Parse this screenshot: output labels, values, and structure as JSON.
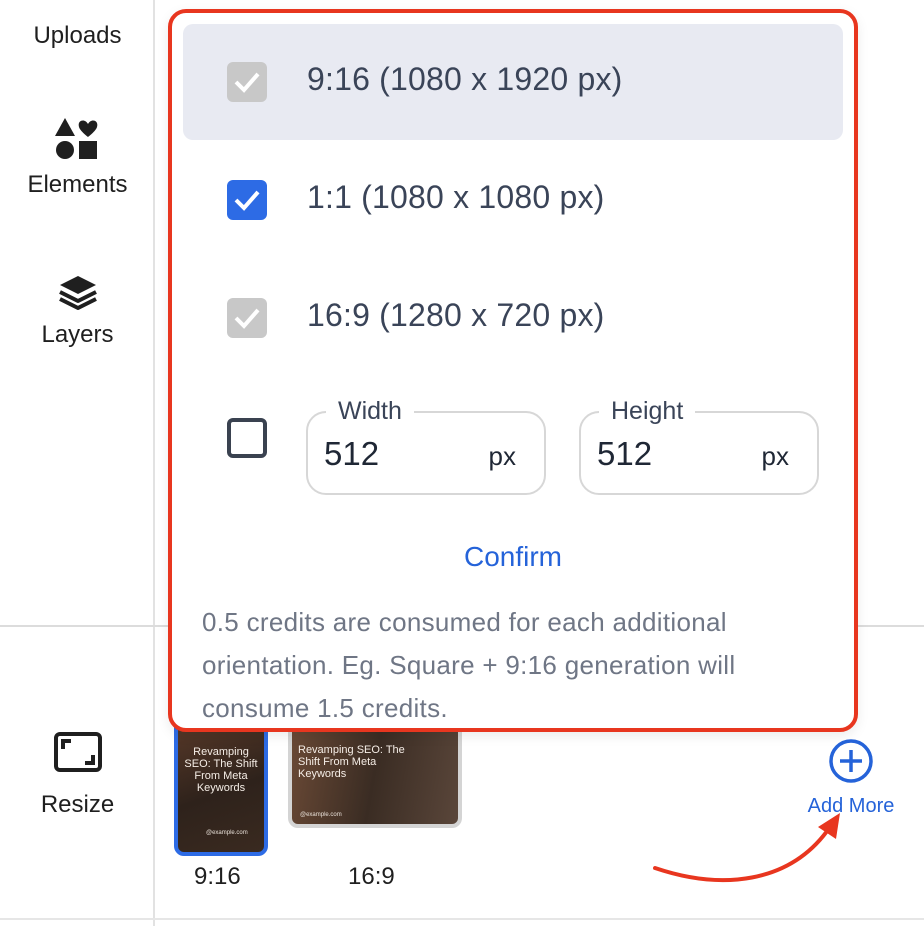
{
  "sidebar": {
    "uploads_label": "Uploads",
    "elements_label": "Elements",
    "elements_icon": "shapes-icon",
    "layers_label": "Layers",
    "layers_icon": "layers-icon",
    "resize_label": "Resize",
    "resize_icon": "resize-icon"
  },
  "popup": {
    "options": [
      {
        "label": "9:16 (1080 x 1920 px)",
        "state": "checked-disabled"
      },
      {
        "label": "1:1 (1080 x 1080 px)",
        "state": "checked"
      },
      {
        "label": "16:9 (1280 x 720 px)",
        "state": "checked-disabled"
      }
    ],
    "custom": {
      "checked": false,
      "width_label": "Width",
      "width_value": "512",
      "width_unit": "px",
      "height_label": "Height",
      "height_value": "512",
      "height_unit": "px"
    },
    "confirm_label": "Confirm",
    "note": "0.5 credits are consumed for each additional orientation. Eg. Square + 9:16 generation will consume 1.5 credits."
  },
  "thumbnails": [
    {
      "caption": "9:16",
      "title": "Revamping SEO: The Shift From Meta Keywords",
      "footer": "@example.com",
      "selected": true
    },
    {
      "caption": "16:9",
      "title": "Revamping SEO: The Shift From Meta Keywords",
      "footer": "@example.com",
      "selected": false
    }
  ],
  "add_more_label": "Add More",
  "colors": {
    "accent": "#2563d9",
    "highlight_border": "#e8361f",
    "disabled_check": "#c8c8c8"
  }
}
